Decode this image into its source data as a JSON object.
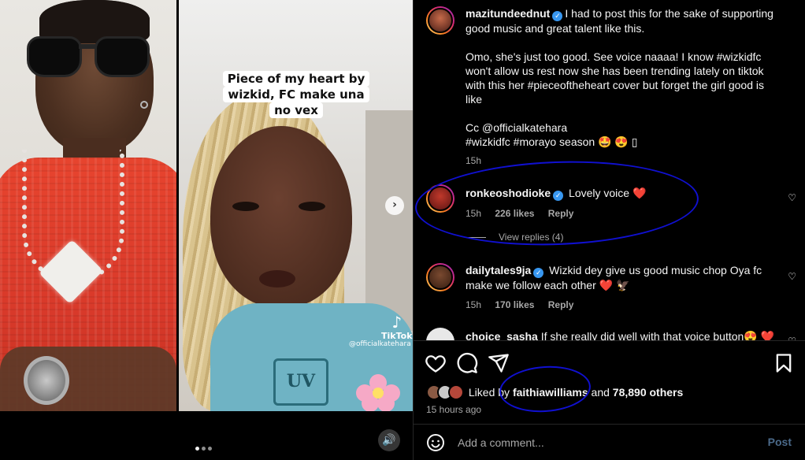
{
  "media": {
    "overlay_caption": "Piece of my heart by wizkid, FC make una no vex",
    "tiktok_label": "TikTok",
    "tiktok_handle": "@officialkatehara",
    "shirt_text": "UV",
    "carousel_dots": 3,
    "active_dot": 0
  },
  "caption": {
    "username": "mazitundeednut",
    "paragraphs": [
      "I had to post this for the sake of supporting good music and great talent like this.",
      "Omo, she's just too good. See voice naaaa! I know #wizkidfc won't allow us rest now she has been trending lately on tiktok with this her #pieceoftheheart cover but forget the girl good is like",
      "Cc @officialkatehara\n#wizkidfc #morayo season 🤩 😍 ▯"
    ],
    "time": "15h"
  },
  "comments": [
    {
      "username": "ronkeoshodioke",
      "text": "Lovely voice ❤️",
      "time": "15h",
      "likes": "226 likes",
      "reply": "Reply",
      "view_replies": "View replies (4)"
    },
    {
      "username": "dailytales9ja",
      "text": "Wizkid dey give us good music chop Oya fc make we follow each other ❤️ 🦅",
      "time": "15h",
      "likes": "170 likes",
      "reply": "Reply"
    },
    {
      "username": "choice_sasha",
      "text": "If she really did well with that voice button😍 ❤️"
    }
  ],
  "likes": {
    "prefix": "Liked by",
    "user": "faithiawilliams",
    "and": "and",
    "others": "78,890 others",
    "time": "15 hours ago"
  },
  "add_comment": {
    "placeholder": "Add a comment...",
    "post_label": "Post"
  },
  "colors": {
    "background": "#000000",
    "verified": "#3897f0",
    "heart": "#ed4956",
    "annotation": "#1010d0",
    "post_disabled": "#4b6a8a"
  },
  "icons": [
    "heart-icon",
    "comment-icon",
    "share-icon",
    "bookmark-icon",
    "emoji-icon",
    "verified-icon",
    "chevron-right-icon",
    "speaker-icon"
  ]
}
